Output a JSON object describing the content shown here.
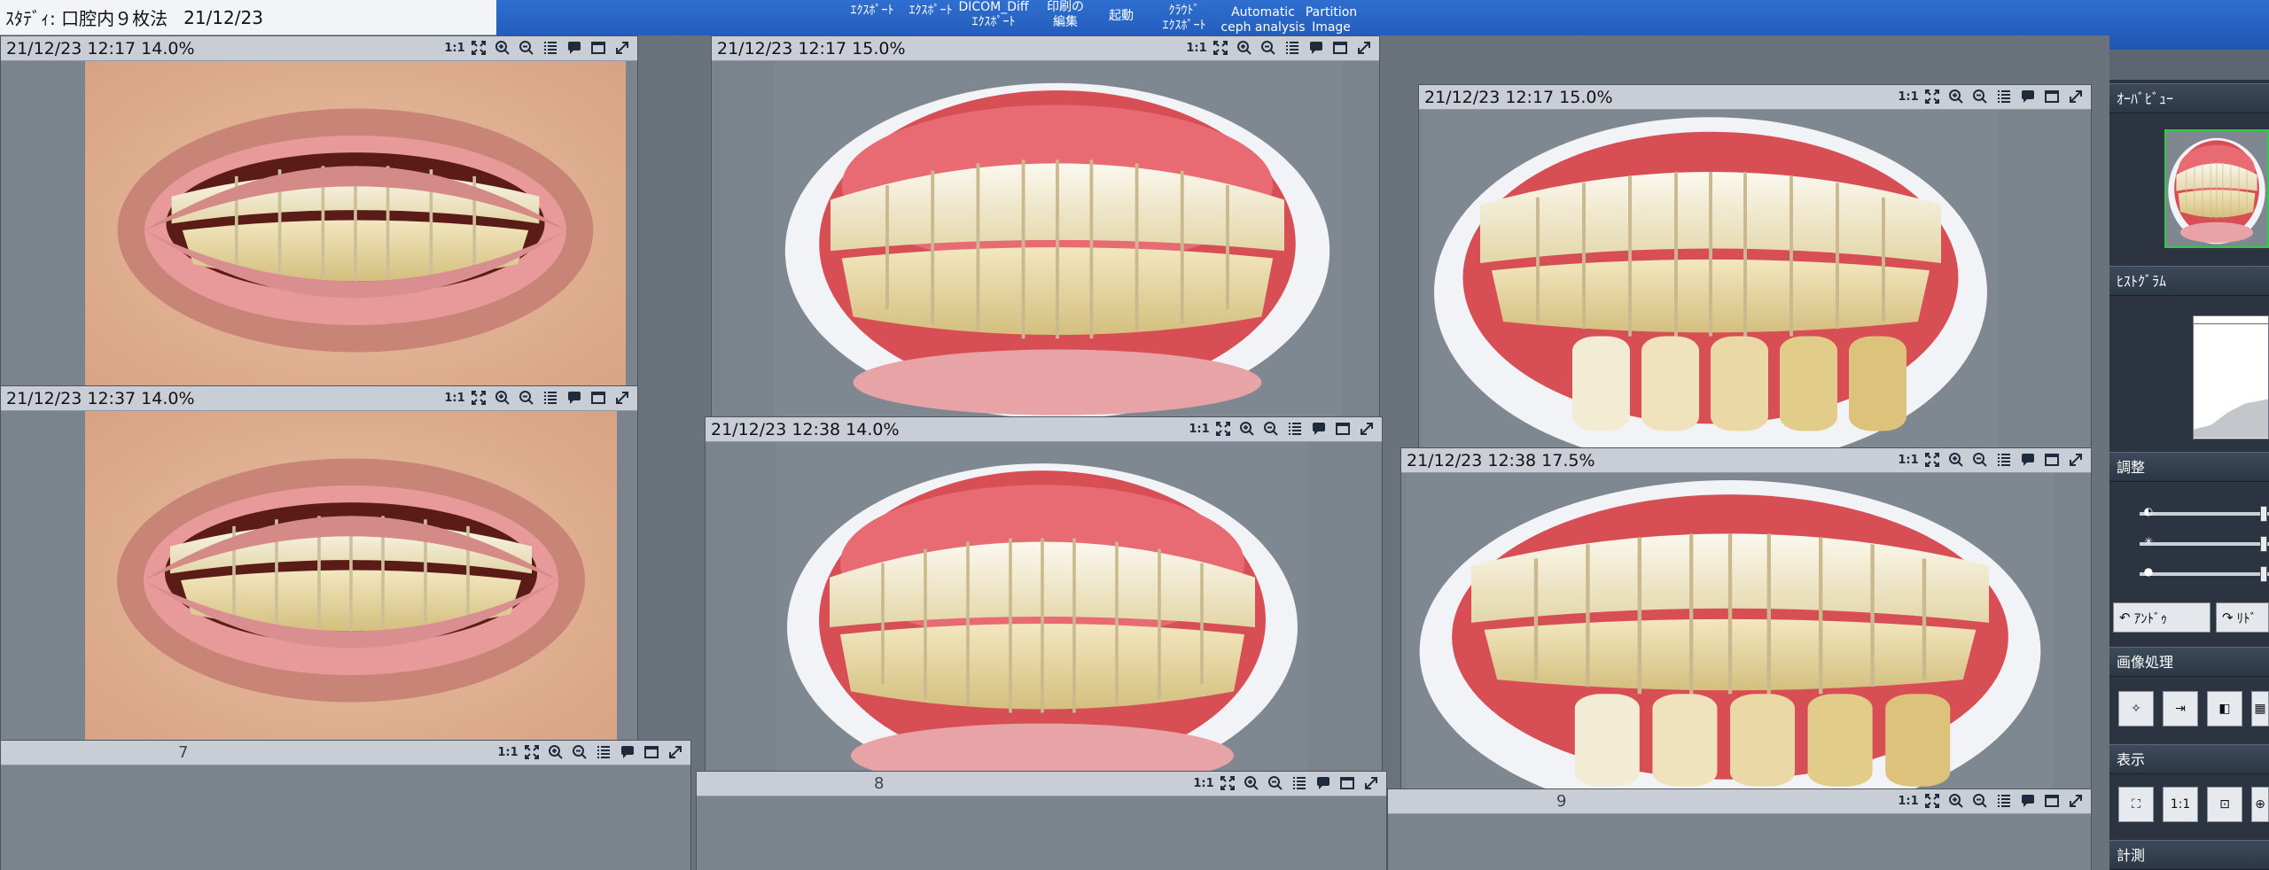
{
  "toolbar": {
    "buttons": [
      {
        "label": "ｴｸｽﾎﾟｰﾄ"
      },
      {
        "label": "ｴｸｽﾎﾟｰﾄ"
      },
      {
        "label": "DICOM_Diff\nｴｸｽﾎﾟｰﾄ"
      },
      {
        "label": "印刷の\n編集"
      },
      {
        "label": "起動"
      },
      {
        "label": "ｸﾗｳﾄﾞ\nｴｸｽﾎﾟｰﾄ"
      },
      {
        "label": "Automatic\nceph analysis"
      },
      {
        "label": "Partition\nImage"
      }
    ]
  },
  "study": {
    "prefix": "ｽﾀﾃﾞｨ:",
    "name": "口腔内９枚法",
    "date": "21/12/23"
  },
  "panels": [
    {
      "info": "21/12/23 12:17   14.0%"
    },
    {
      "info": "21/12/23 12:17   15.0%"
    },
    {
      "info": "21/12/23 12:17   15.0%"
    },
    {
      "info": "21/12/23 12:37   14.0%"
    },
    {
      "info": "21/12/23 12:38   14.0%"
    },
    {
      "info": "21/12/23 12:38   17.5%"
    },
    {
      "num": "7"
    },
    {
      "num": "8"
    },
    {
      "num": "9"
    }
  ],
  "panel_icon_labels": {
    "one_to_one": "1:1"
  },
  "sidebar": {
    "overview_title": "ｵｰﾊﾞﾋﾞｭｰ",
    "histogram_title": "ﾋｽﾄｸﾞﾗﾑ",
    "adjust_title": "調整",
    "undo_label": "ｱﾝﾄﾞｩ",
    "redo_label": "ﾘﾄﾞ",
    "image_processing_title": "画像処理",
    "display_title": "表示",
    "display_one_to_one": "1:1",
    "measure_title": "計測"
  },
  "colors": {
    "toolbar": "#2563c4",
    "overview_border": "#2ecc40"
  }
}
